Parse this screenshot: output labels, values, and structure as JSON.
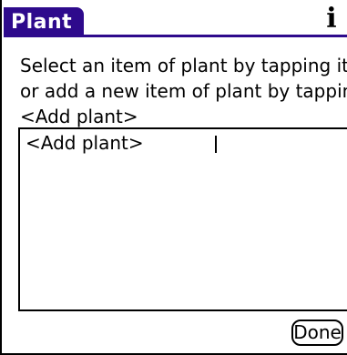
{
  "header": {
    "title": "Plant",
    "info_icon": "info-icon",
    "accent_color": "#2e0a8c"
  },
  "instructions": {
    "line1": "Select an item of plant by tapping it",
    "line2": "or add a new item of plant by tapping",
    "line3": "<Add plant>"
  },
  "list": {
    "items": [
      {
        "label": "<Add plant>",
        "detail": ""
      }
    ]
  },
  "footer": {
    "done_label": "Done"
  }
}
